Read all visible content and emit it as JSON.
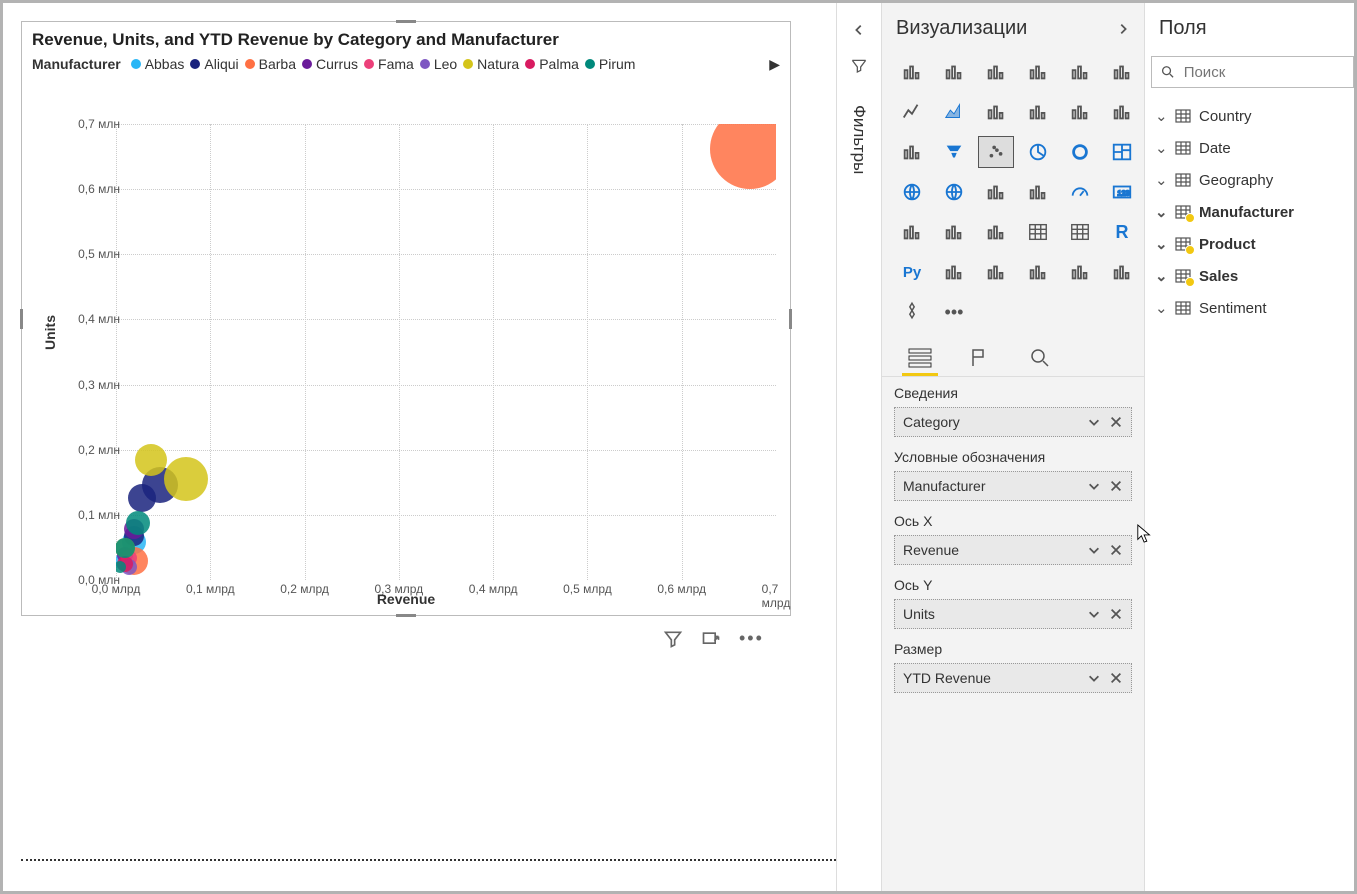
{
  "chart": {
    "title": "Revenue, Units, and YTD Revenue by Category and Manufacturer",
    "legend_label": "Manufacturer",
    "legend_items": [
      {
        "name": "Abbas",
        "color": "#29b6f6"
      },
      {
        "name": "Aliqui",
        "color": "#1a237e"
      },
      {
        "name": "Barba",
        "color": "#ff7043"
      },
      {
        "name": "Currus",
        "color": "#6a1b9a"
      },
      {
        "name": "Fama",
        "color": "#ec407a"
      },
      {
        "name": "Leo",
        "color": "#7e57c2"
      },
      {
        "name": "Natura",
        "color": "#d4c41a"
      },
      {
        "name": "Palma",
        "color": "#d81b60"
      },
      {
        "name": "Pirum",
        "color": "#00897b"
      }
    ],
    "x_axis_title": "Revenue",
    "y_axis_title": "Units",
    "y_ticks": [
      "0,0 млн",
      "0,1 млн",
      "0,2 млн",
      "0,3 млн",
      "0,4 млн",
      "0,5 млн",
      "0,6 млн",
      "0,7 млн"
    ],
    "x_ticks": [
      "0,0 млрд",
      "0,1 млрд",
      "0,2 млрд",
      "0,3 млрд",
      "0,4 млрд",
      "0,5 млрд",
      "0,6 млрд",
      "0,7 млрд"
    ]
  },
  "chart_data": {
    "type": "scatter",
    "title": "Revenue, Units, and YTD Revenue by Category and Manufacturer",
    "xlabel": "Revenue",
    "ylabel": "Units",
    "xlim": [
      0,
      0.75
    ],
    "ylim": [
      0,
      0.72
    ],
    "x_unit": "млрд",
    "y_unit": "млн",
    "size_field": "YTD Revenue",
    "series": [
      {
        "name": "Abbas",
        "color": "#29b6f6",
        "points": [
          {
            "x": 0.01,
            "y": 0.03,
            "r": 10
          },
          {
            "x": 0.02,
            "y": 0.06,
            "r": 12
          }
        ]
      },
      {
        "name": "Aliqui",
        "color": "#1a237e",
        "points": [
          {
            "x": 0.03,
            "y": 0.13,
            "r": 14
          },
          {
            "x": 0.05,
            "y": 0.15,
            "r": 18
          },
          {
            "x": 0.02,
            "y": 0.07,
            "r": 10
          }
        ]
      },
      {
        "name": "Barba",
        "color": "#ff7043",
        "points": [
          {
            "x": 0.02,
            "y": 0.03,
            "r": 14
          },
          {
            "x": 0.72,
            "y": 0.68,
            "r": 40
          }
        ]
      },
      {
        "name": "Currus",
        "color": "#6a1b9a",
        "points": [
          {
            "x": 0.02,
            "y": 0.08,
            "r": 10
          },
          {
            "x": 0.01,
            "y": 0.04,
            "r": 8
          }
        ]
      },
      {
        "name": "Fama",
        "color": "#ec407a",
        "points": [
          {
            "x": 0.015,
            "y": 0.035,
            "r": 8
          }
        ]
      },
      {
        "name": "Leo",
        "color": "#7e57c2",
        "points": [
          {
            "x": 0.015,
            "y": 0.02,
            "r": 8
          }
        ]
      },
      {
        "name": "Natura",
        "color": "#d4c41a",
        "points": [
          {
            "x": 0.04,
            "y": 0.19,
            "r": 16
          },
          {
            "x": 0.08,
            "y": 0.16,
            "r": 22
          },
          {
            "x": 0.01,
            "y": 0.05,
            "r": 10
          }
        ]
      },
      {
        "name": "Palma",
        "color": "#d81b60",
        "points": [
          {
            "x": 0.01,
            "y": 0.025,
            "r": 8
          }
        ]
      },
      {
        "name": "Pirum",
        "color": "#00897b",
        "points": [
          {
            "x": 0.01,
            "y": 0.05,
            "r": 10
          },
          {
            "x": 0.025,
            "y": 0.09,
            "r": 12
          },
          {
            "x": 0.005,
            "y": 0.02,
            "r": 6
          }
        ]
      }
    ]
  },
  "filters_label": "Фильтры",
  "viz_panel": {
    "title": "Визуализации",
    "tabs": {
      "fields_label": "Сведения"
    },
    "wells": [
      {
        "label": "Сведения",
        "value": "Category"
      },
      {
        "label": "Условные обозначения",
        "value": "Manufacturer"
      },
      {
        "label": "Ось X",
        "value": "Revenue"
      },
      {
        "label": "Ось Y",
        "value": "Units"
      },
      {
        "label": "Размер",
        "value": "YTD Revenue"
      }
    ]
  },
  "fields_panel": {
    "title": "Поля",
    "search_placeholder": "Поиск",
    "tables": [
      {
        "name": "Country",
        "used": false
      },
      {
        "name": "Date",
        "used": false
      },
      {
        "name": "Geography",
        "used": false
      },
      {
        "name": "Manufacturer",
        "used": true
      },
      {
        "name": "Product",
        "used": true
      },
      {
        "name": "Sales",
        "used": true
      },
      {
        "name": "Sentiment",
        "used": false
      }
    ]
  }
}
